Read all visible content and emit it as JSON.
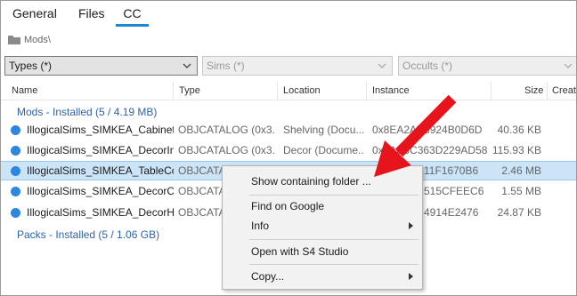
{
  "tabs": [
    {
      "label": "General"
    },
    {
      "label": "Files"
    },
    {
      "label": "CC"
    }
  ],
  "breadcrumb": {
    "path": "Mods\\"
  },
  "filters": {
    "types": "Types (*)",
    "sims": "Sims (*)",
    "occults": "Occults (*)"
  },
  "columns": [
    "Name",
    "Type",
    "Location",
    "Instance",
    "Size",
    "Creato"
  ],
  "groups": {
    "mods": "Mods - Installed  (5 / 4.19 MB)",
    "packs": "Packs - Installed  (5 / 1.06 GB)"
  },
  "rows": [
    {
      "name": "IllogicalSims_SIMKEA_Cabinet_...",
      "type": "OBJCATALOG (0x3...",
      "location": "Shelving (Docu...",
      "instance": "0x8EA2A7B924B0D6D",
      "size": "40.36 KB"
    },
    {
      "name": "IllogicalSims_SIMKEA_DecorIns...",
      "type": "OBJCATALOG (0x3...",
      "location": "Decor (Docume...",
      "instance": "0x8A8BC363D229AD5874",
      "size": "115.93 KB"
    },
    {
      "name": "IllogicalSims_SIMKEA_TableCo...",
      "type": "OBJCATAL",
      "location": "",
      "instance": "11F1670B6",
      "size": "2.46 MB"
    },
    {
      "name": "IllogicalSims_SIMKEA_DecorCh...",
      "type": "OBJCATAL",
      "location": "",
      "instance": "515CFEEC6",
      "size": "1.55 MB"
    },
    {
      "name": "IllogicalSims_SIMKEA_DecorHa...",
      "type": "OBJCATAL",
      "location": "",
      "instance": "4914E2476",
      "size": "24.87 KB"
    }
  ],
  "context_menu": {
    "show_folder": "Show containing folder ...",
    "find_google": "Find on Google",
    "info": "Info",
    "open_s4": "Open with S4 Studio",
    "copy": "Copy..."
  },
  "colors": {
    "accent": "#1e88d2",
    "group_text": "#2e63a8",
    "dot": "#2e86de",
    "selection": "#cce4f7",
    "annotation_arrow": "#e8141b"
  }
}
